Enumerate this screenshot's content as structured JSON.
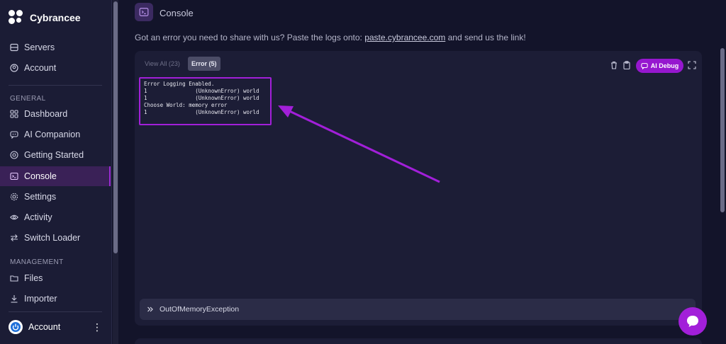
{
  "brand": {
    "name": "Cybrancee"
  },
  "sidebar": {
    "top_items": [
      {
        "label": "Servers",
        "icon": "server-icon"
      },
      {
        "label": "Account",
        "icon": "user-circle-icon"
      }
    ],
    "general_label": "GENERAL",
    "general_items": [
      {
        "label": "Dashboard",
        "icon": "grid-icon"
      },
      {
        "label": "AI Companion",
        "icon": "robot-chat-icon"
      },
      {
        "label": "Getting Started",
        "icon": "lifebuoy-icon"
      },
      {
        "label": "Console",
        "icon": "terminal-icon",
        "active": true
      },
      {
        "label": "Settings",
        "icon": "gear-icon"
      },
      {
        "label": "Activity",
        "icon": "eye-icon"
      },
      {
        "label": "Switch Loader",
        "icon": "swap-arrows-icon"
      }
    ],
    "management_label": "MANAGEMENT",
    "management_items": [
      {
        "label": "Files",
        "icon": "folder-icon"
      },
      {
        "label": "Importer",
        "icon": "download-icon"
      }
    ],
    "bottom_account": {
      "label": "Account"
    }
  },
  "page": {
    "title": "Console",
    "info_prefix": "Got an error you need to share with us? Paste the logs onto: ",
    "info_link": "paste.cybrancee.com",
    "info_suffix": " and send us the link!"
  },
  "console": {
    "tabs": [
      {
        "label": "View All (23)",
        "active": false
      },
      {
        "label": "Error (5)",
        "active": true
      }
    ],
    "ai_debug_label": "AI Debug",
    "log_lines": [
      "Error Logging Enabled.",
      "1               (UnknownError) world",
      "1               (UnknownError) world",
      "Choose World: memory error",
      "1               (UnknownError) world"
    ],
    "exception_label": "OutOfMemoryException"
  },
  "colors": {
    "accent": "#9c1fd6",
    "background": "#13142a",
    "sidebar": "#1b1c35",
    "panel": "#1c1d36"
  }
}
